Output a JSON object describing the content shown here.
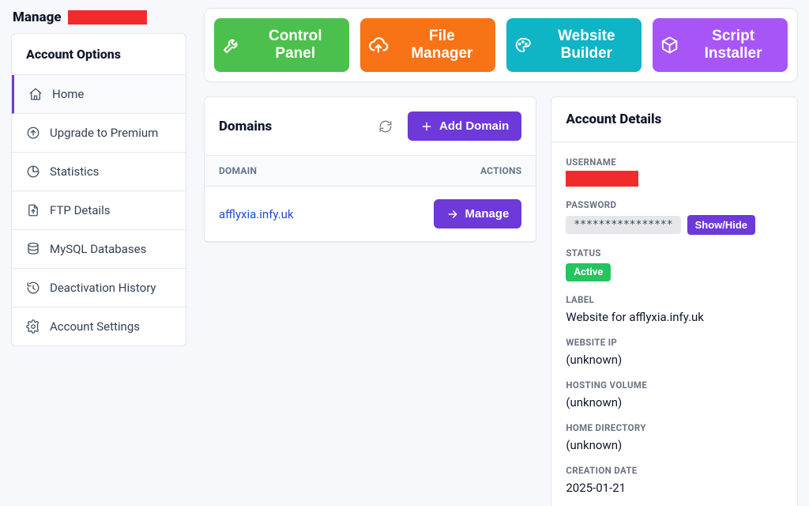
{
  "sidebar": {
    "title": "Manage",
    "heading": "Account Options",
    "items": [
      {
        "label": "Home",
        "icon": "home",
        "active": true
      },
      {
        "label": "Upgrade to Premium",
        "icon": "arrow-up-circle"
      },
      {
        "label": "Statistics",
        "icon": "pie"
      },
      {
        "label": "FTP Details",
        "icon": "file-arrow"
      },
      {
        "label": "MySQL Databases",
        "icon": "database"
      },
      {
        "label": "Deactivation History",
        "icon": "history"
      },
      {
        "label": "Account Settings",
        "icon": "gear"
      }
    ]
  },
  "actionbar": [
    {
      "label": "Control Panel",
      "icon": "wrench",
      "color": "green"
    },
    {
      "label": "File Manager",
      "icon": "cloud-upload",
      "color": "orange"
    },
    {
      "label": "Website Builder",
      "icon": "palette",
      "color": "teal"
    },
    {
      "label": "Script Installer",
      "icon": "cube",
      "color": "violet"
    }
  ],
  "domains": {
    "title": "Domains",
    "add_label": "Add Domain",
    "columns": {
      "domain": "DOMAIN",
      "actions": "ACTIONS"
    },
    "rows": [
      {
        "domain": "afflyxia.infy.uk",
        "action": "Manage"
      }
    ]
  },
  "details": {
    "title": "Account Details",
    "labels": {
      "username": "USERNAME",
      "password": "PASSWORD",
      "status": "STATUS",
      "label": "LABEL",
      "website_ip": "WEBSITE IP",
      "hosting_volume": "HOSTING VOLUME",
      "home_directory": "HOME DIRECTORY",
      "creation_date": "CREATION DATE"
    },
    "values": {
      "username_redacted": true,
      "password_mask": "****************",
      "showhide": "Show/Hide",
      "status_badge": "Active",
      "label": "Website for afflyxia.infy.uk",
      "website_ip": "(unknown)",
      "hosting_volume": "(unknown)",
      "home_directory": "(unknown)",
      "creation_date": "2025-01-21"
    }
  },
  "colors": {
    "purple": "#6d39d9"
  }
}
